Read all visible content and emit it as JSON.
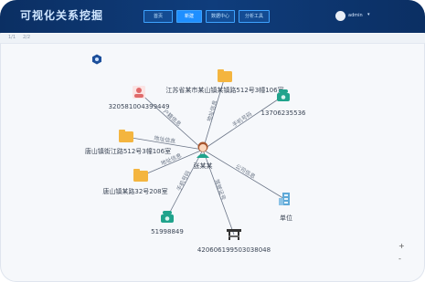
{
  "app": {
    "title": "可视化关系挖掘"
  },
  "nav": [
    {
      "label": "首页"
    },
    {
      "label": "新建"
    },
    {
      "label": "数据中心"
    },
    {
      "label": "分析工具"
    }
  ],
  "user": {
    "name": "admin"
  },
  "breadcrumb": [
    "1/1",
    "2/2"
  ],
  "graph": {
    "center": {
      "label": "张某某",
      "icon": "person-female-icon"
    },
    "nodes": [
      {
        "id": "id1",
        "label": "320581004399449",
        "icon": "person-id-icon"
      },
      {
        "id": "addr1",
        "label": "江苏省某市某山镇某镇路512号3幢106室",
        "icon": "folder-icon"
      },
      {
        "id": "phone1",
        "label": "13706235536",
        "icon": "phone-icon"
      },
      {
        "id": "addr2",
        "label": "唐山镇街江路512号3幢106室",
        "icon": "folder-icon"
      },
      {
        "id": "addr3",
        "label": "唐山镇某路32号208室",
        "icon": "folder-icon"
      },
      {
        "id": "phone2",
        "label": "51998849",
        "icon": "phone-icon"
      },
      {
        "id": "car",
        "label": "420606199503038048",
        "icon": "vehicle-icon"
      },
      {
        "id": "company",
        "label": "单位",
        "icon": "building-icon"
      }
    ],
    "edges": [
      {
        "to": "id1",
        "label": "户籍信息"
      },
      {
        "to": "addr1",
        "label": "地址信息"
      },
      {
        "to": "phone1",
        "label": "手机号码"
      },
      {
        "to": "addr2",
        "label": "地址信息"
      },
      {
        "to": "addr3",
        "label": "地址信息"
      },
      {
        "to": "phone2",
        "label": "手机号码"
      },
      {
        "to": "car",
        "label": "驾驶证号"
      },
      {
        "to": "company",
        "label": "公司信息"
      }
    ]
  },
  "colors": {
    "header_bg": "#0b2f63",
    "accent": "#1f8fff",
    "edge": "#6a7486",
    "folder": "#f4b53f",
    "phone": "#20a38c",
    "person_id": "#e06b6b",
    "building": "#5fa9d8"
  },
  "zoom": {
    "in": "+",
    "out": "-"
  }
}
